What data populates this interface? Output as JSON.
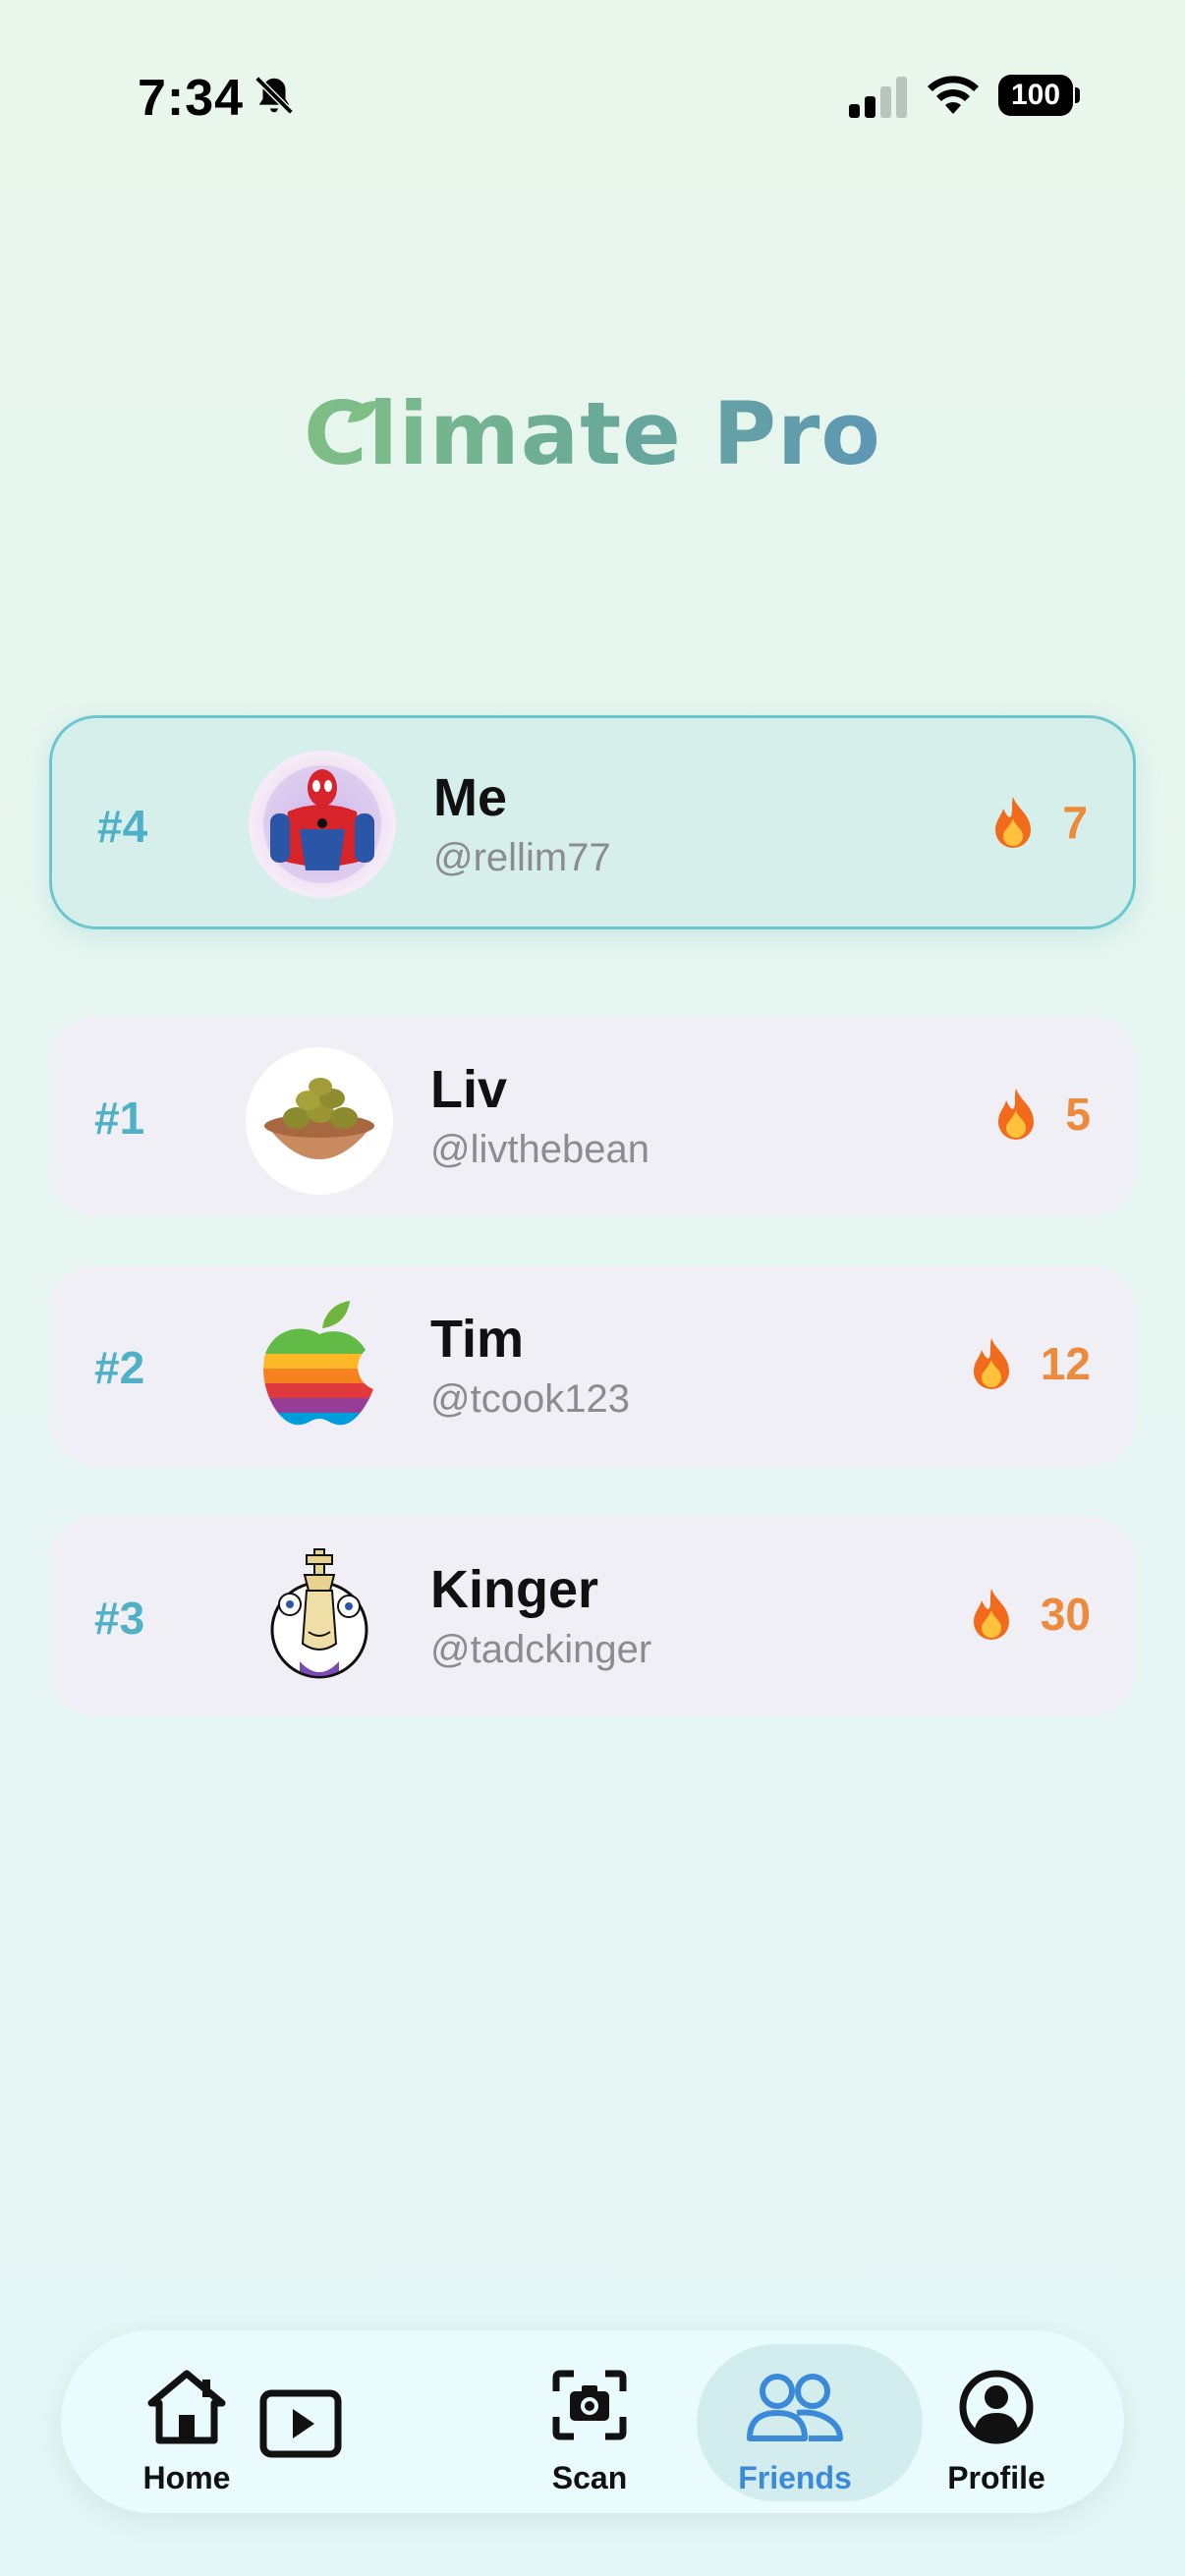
{
  "status_bar": {
    "time": "7:34",
    "battery": "100"
  },
  "app": {
    "title": "Climate Pro"
  },
  "me": {
    "rank": "#4",
    "name": "Me",
    "handle": "@rellim77",
    "streak": "7"
  },
  "friends": [
    {
      "rank": "#1",
      "name": "Liv",
      "handle": "@livthebean",
      "streak": "5"
    },
    {
      "rank": "#2",
      "name": "Tim",
      "handle": "@tcook123",
      "streak": "12"
    },
    {
      "rank": "#3",
      "name": "Kinger",
      "handle": "@tadckinger",
      "streak": "30"
    }
  ],
  "nav": {
    "items": [
      {
        "label": "Home",
        "icon": "home-icon"
      },
      {
        "label": "",
        "icon": "play-icon"
      },
      {
        "label": "Scan",
        "icon": "camera-scan-icon"
      },
      {
        "label": "Friends",
        "icon": "friends-icon",
        "active": true
      },
      {
        "label": "Profile",
        "icon": "profile-icon"
      }
    ]
  },
  "colors": {
    "accent": "#4fb0c6",
    "streak": "#ee8a3c",
    "active_nav": "#3a8ad9"
  }
}
